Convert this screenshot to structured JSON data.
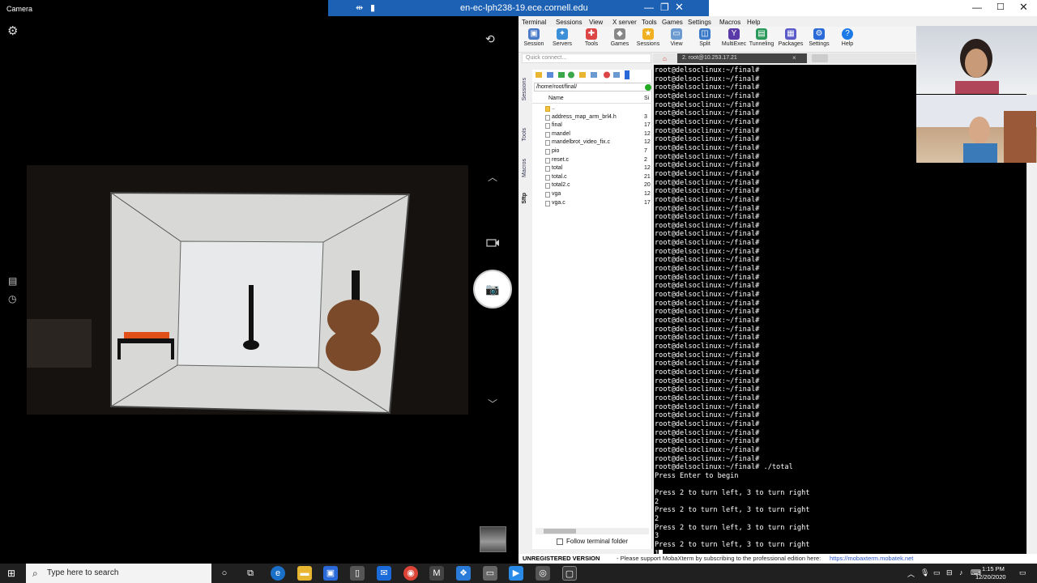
{
  "camera": {
    "title": "Camera"
  },
  "remote": {
    "title": "en-ec-lph238-19.ece.cornell.edu"
  },
  "moba": {
    "menu": [
      "Terminal",
      "Sessions",
      "View",
      "X server",
      "Tools",
      "Games",
      "Settings",
      "Macros",
      "Help"
    ],
    "toolbar": [
      "Session",
      "Servers",
      "Tools",
      "Games",
      "Sessions",
      "View",
      "Split",
      "MultiExec",
      "Tunneling",
      "Packages",
      "Settings",
      "Help"
    ],
    "quick_connect_placeholder": "Quick connect...",
    "session_tab": "2. root@10.253.17.21",
    "side_tabs": [
      "Sessions",
      "Tools",
      "Macros",
      "Sftp"
    ],
    "fb": {
      "path": "/home/root/final/",
      "col_name": "Name",
      "col_size": "Si",
      "files": [
        {
          "name": "..",
          "size": ""
        },
        {
          "name": "address_map_arm_brl4.h",
          "size": "3"
        },
        {
          "name": "final",
          "size": "17"
        },
        {
          "name": "mandel",
          "size": "12"
        },
        {
          "name": "mandelbrot_video_fix.c",
          "size": "12"
        },
        {
          "name": "pio",
          "size": "7"
        },
        {
          "name": "reset.c",
          "size": "2"
        },
        {
          "name": "total",
          "size": "12"
        },
        {
          "name": "total.c",
          "size": "21"
        },
        {
          "name": "total2.c",
          "size": "20"
        },
        {
          "name": "vga",
          "size": "12"
        },
        {
          "name": "vga.c",
          "size": "17"
        }
      ],
      "follow_label": "Follow terminal folder"
    },
    "terminal": {
      "prompt": "root@delsoclinux:~/final#",
      "prompt_count": 46,
      "tail": [
        "root@delsoclinux:~/final# ./total",
        "Press Enter to begin",
        "",
        "Press 2 to turn left, 3 to turn right",
        "2",
        "Press 2 to turn left, 3 to turn right",
        "2",
        "Press 2 to turn left, 3 to turn right",
        "3",
        "Press 2 to turn left, 3 to turn right",
        "1"
      ]
    },
    "status": {
      "unregistered": "UNREGISTERED VERSION",
      "message": "-  Please support MobaXterm by subscribing to the professional edition here:",
      "link": "https://mobaxterm.mobatek.net"
    }
  },
  "taskbar": {
    "search_placeholder": "Type here to search",
    "time": "1:15 PM",
    "date": "12/20/2020"
  },
  "icons": {
    "camera_settings": "gear-icon",
    "camera_switch": "camera-switch-icon",
    "shutter": "camera-icon",
    "start": "windows-logo-icon"
  },
  "colors": {
    "remote_bar": "#1d61b5",
    "taskbar": "#202020",
    "terminal_bg": "#000000"
  }
}
